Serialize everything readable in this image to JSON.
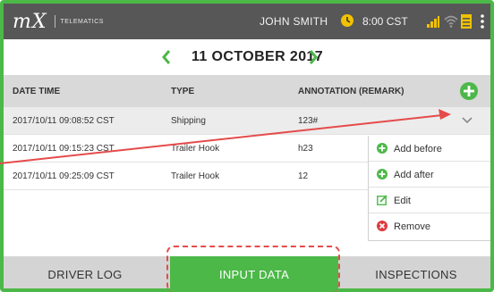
{
  "header": {
    "logo_text": "mX",
    "logo_subtitle": "TELEMATICS",
    "user_name": "JOHN SMITH",
    "time": "8:00 CST",
    "icons": [
      "clock-icon",
      "signal-icon",
      "wifi-icon",
      "document-icon",
      "more-vert-icon"
    ]
  },
  "date_nav": {
    "date": "11 OCTOBER 2017"
  },
  "table": {
    "columns": [
      "DATE TIME",
      "TYPE",
      "ANNOTATION (REMARK)"
    ],
    "rows": [
      {
        "datetime": "2017/10/11 09:08:52 CST",
        "type": "Shipping",
        "annotation": "123#"
      },
      {
        "datetime": "2017/10/11 09:15:23 CST",
        "type": "Trailer Hook",
        "annotation": "h23"
      },
      {
        "datetime": "2017/10/11 09:25:09 CST",
        "type": "Trailer Hook",
        "annotation": "12"
      }
    ]
  },
  "context_menu": {
    "items": [
      "Add before",
      "Add after",
      "Edit",
      "Remove"
    ]
  },
  "tabs": {
    "items": [
      "DRIVER LOG",
      "INPUT DATA",
      "INSPECTIONS"
    ],
    "active": "INPUT DATA"
  },
  "colors": {
    "accent": "#4cb848",
    "header_bg": "#575757",
    "remove": "#e0383e",
    "annotation": "#e54b4b"
  }
}
